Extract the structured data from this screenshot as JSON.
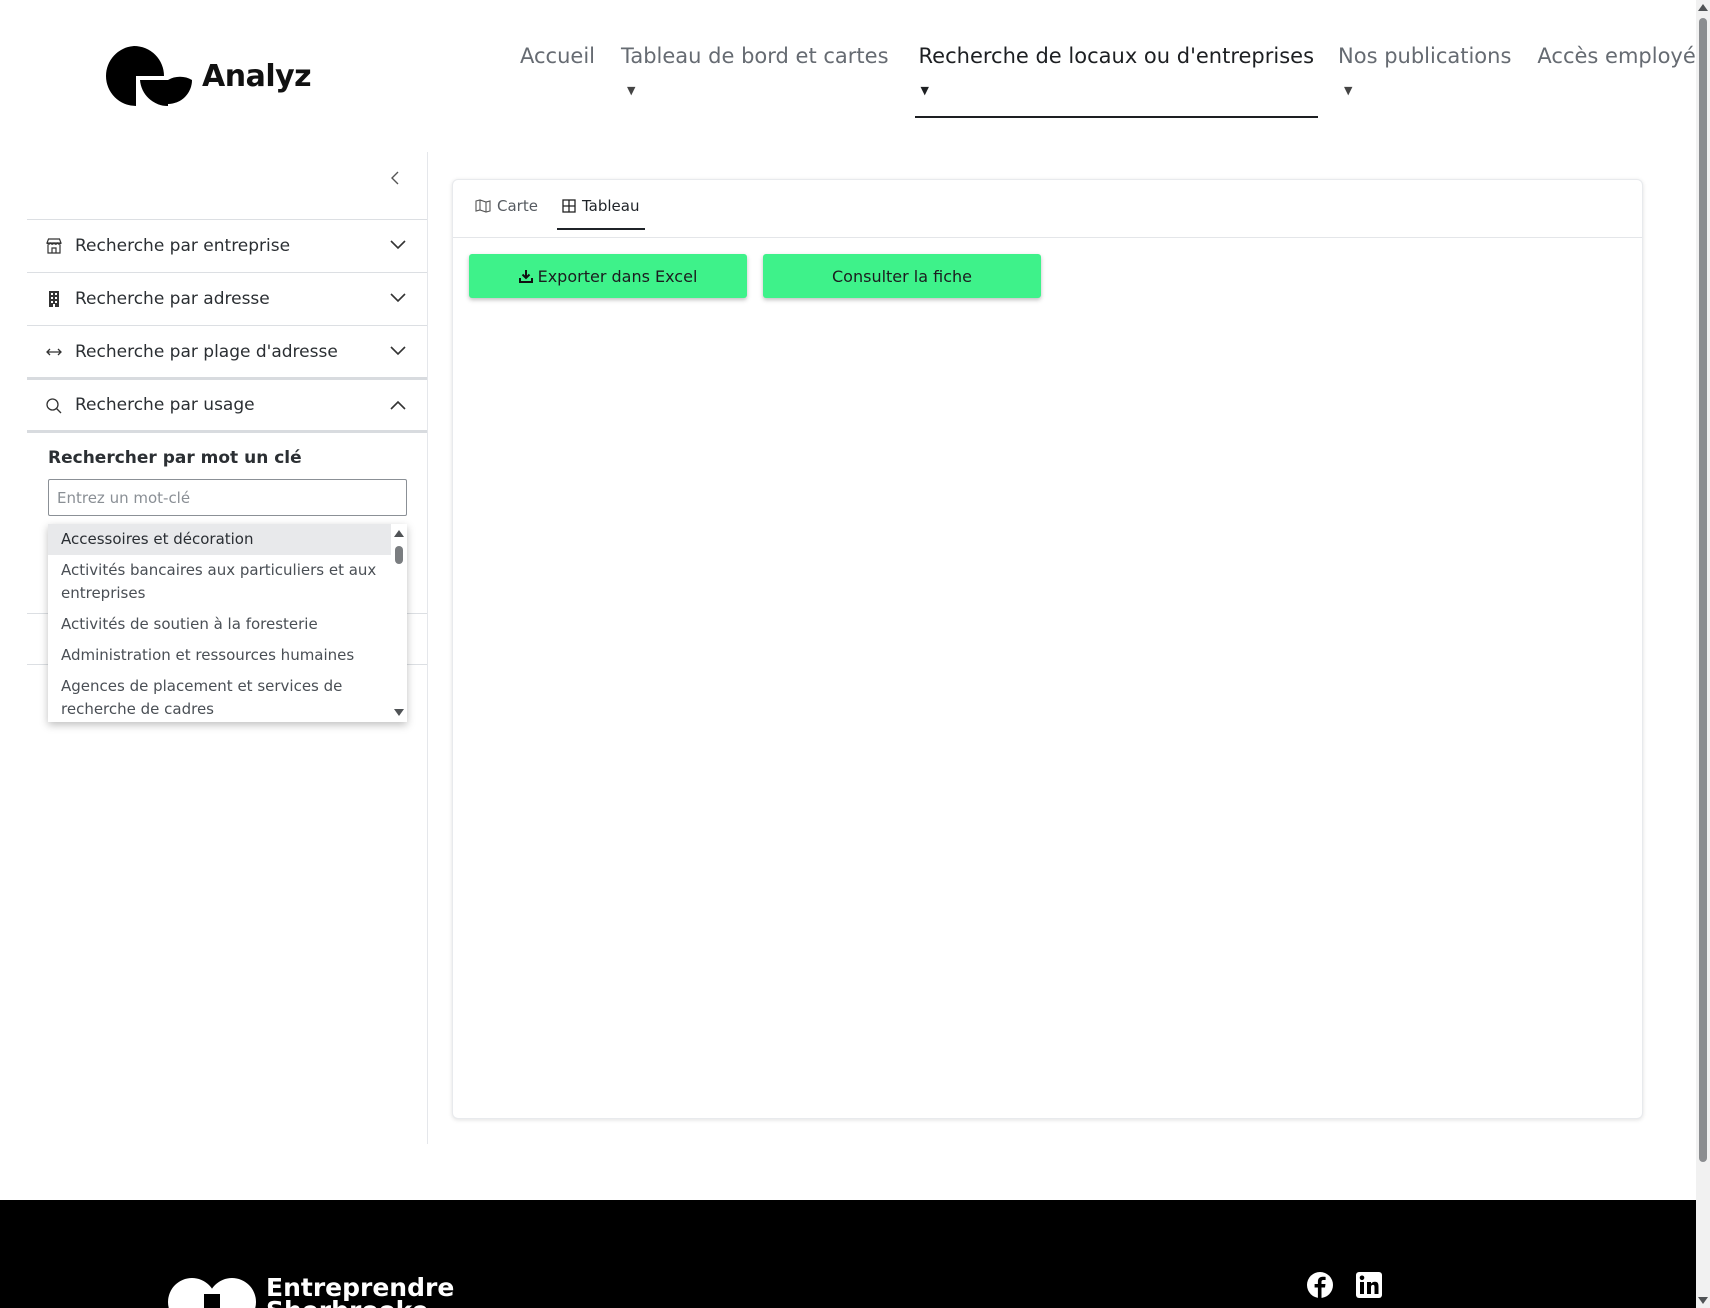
{
  "brand": {
    "name": "Analyz"
  },
  "nav": {
    "items": [
      {
        "label": "Accueil"
      },
      {
        "label": "Tableau de bord et cartes"
      },
      {
        "label": "Recherche de locaux ou d'entreprises"
      },
      {
        "label": "Nos publications"
      },
      {
        "label": "Accès employé"
      }
    ]
  },
  "sidebar": {
    "sections": [
      {
        "label": "Recherche par entreprise",
        "icon": "store-icon",
        "state": "collapsed"
      },
      {
        "label": "Recherche par adresse",
        "icon": "building-icon",
        "state": "collapsed"
      },
      {
        "label": "Recherche par plage d'adresse",
        "icon": "range-arrows-icon",
        "state": "collapsed"
      },
      {
        "label": "Recherche par usage",
        "icon": "search-icon",
        "state": "expanded"
      }
    ],
    "keyword": {
      "label": "Rechercher par mot un clé",
      "placeholder": "Entrez un mot-clé",
      "value": ""
    },
    "suggestions": [
      "Accessoires et décoration",
      "Activités bancaires aux particuliers et aux entreprises",
      "Activités de soutien à la foresterie",
      "Administration et ressources humaines",
      "Agences de placement et services de recherche de cadres"
    ]
  },
  "main": {
    "tabs": [
      {
        "label": "Carte",
        "icon": "map-icon",
        "active": false
      },
      {
        "label": "Tableau",
        "icon": "table-icon",
        "active": true
      }
    ],
    "buttons": {
      "export": "Exporter dans Excel",
      "consult": "Consulter la fiche"
    }
  },
  "footer": {
    "brand_line1": "Entreprendre",
    "brand_line2": "Sherbrooke",
    "social": [
      "facebook-icon",
      "linkedin-icon"
    ]
  },
  "colors": {
    "accent_green": "#3ef28a",
    "text_dark": "#1d1f22",
    "nav_text": "#666b72",
    "footer_bg": "#000000"
  }
}
